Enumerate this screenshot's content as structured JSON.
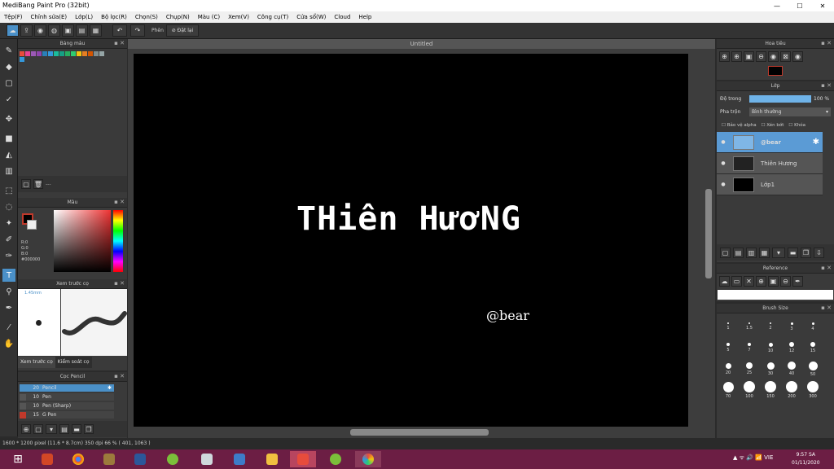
{
  "window": {
    "title": "MediBang Paint Pro (32bit)",
    "controls": [
      "—",
      "☐",
      "✕"
    ]
  },
  "menu": [
    "Tệp(F)",
    "Chỉnh sửa(E)",
    "Lớp(L)",
    "Bộ lọc(R)",
    "Chọn(S)",
    "Chụp(N)",
    "Màu (C)",
    "Xem(V)",
    "Công cụ(T)",
    "Cửa sổ(W)",
    "Cloud",
    "Help"
  ],
  "toolbar": {
    "left_label": "Phên",
    "reset_label": "Đặt lại"
  },
  "panels": {
    "palette_title": "Bảng màu",
    "palette_footer": "---",
    "palette_colors": [
      "#e74c3c",
      "#e84393",
      "#9b59b6",
      "#8e44ad",
      "#2980b9",
      "#3498db",
      "#1abc9c",
      "#16a085",
      "#27ae60",
      "#2ecc71",
      "#f1c40f",
      "#e67e22",
      "#d35400",
      "#7f8c8d",
      "#95a5a6",
      "#3498db"
    ],
    "color_title": "Màu",
    "color_readout": [
      "R:0",
      "G:0",
      "B:0",
      "#000000"
    ],
    "preview_title": "Xem trước cọ",
    "preview_size": "1.45mm",
    "preview_tabs": [
      "Xem trước cọ",
      "Kiểm soát cọ"
    ],
    "brush_title": "Cọc Pencil",
    "brushes": [
      {
        "size": "20",
        "name": "Pencil",
        "color": "#4a90c8"
      },
      {
        "size": "10",
        "name": "Pen",
        "color": "#555"
      },
      {
        "size": "10",
        "name": "Pen (Sharp)",
        "color": "#555"
      },
      {
        "size": "15",
        "name": "G Pen",
        "color": "#c0392b"
      }
    ]
  },
  "canvas": {
    "tab": "Untitled",
    "title_text": "THiên HươNG",
    "sub_text": "@bear"
  },
  "right": {
    "navigator_title": "Hoa tiêu",
    "layer_title": "Lớp",
    "opacity_label": "Độ trong",
    "opacity_value": "100 %",
    "opacity_fraction": 1.0,
    "blend_label": "Pha trộn",
    "blend_value": "Bình thường",
    "checks": [
      "Bảo vệ alpha",
      "Xén bớt",
      "Khóa"
    ],
    "layers": [
      {
        "name": "@bear",
        "selected": true
      },
      {
        "name": "Thiên Hương",
        "selected": false
      },
      {
        "name": "Lớp1",
        "selected": false
      }
    ],
    "reference_title": "Reference",
    "brushsize_title": "Brush Size",
    "brush_sizes": [
      "1",
      "1.5",
      "2",
      "3",
      "4",
      "5",
      "7",
      "10",
      "12",
      "15",
      "20",
      "25",
      "30",
      "40",
      "50",
      "70",
      "100",
      "150",
      "200",
      "300"
    ]
  },
  "status": {
    "text": "1600 * 1200 pixel   (11.6 * 8.7cm)   350 dpi   66 %   ( 401, 1063 )"
  },
  "taskbar": {
    "time": "9:57 SA",
    "date": "01/11/2020",
    "tray": "▲  ᯤ  🔊  📶  VIE"
  }
}
